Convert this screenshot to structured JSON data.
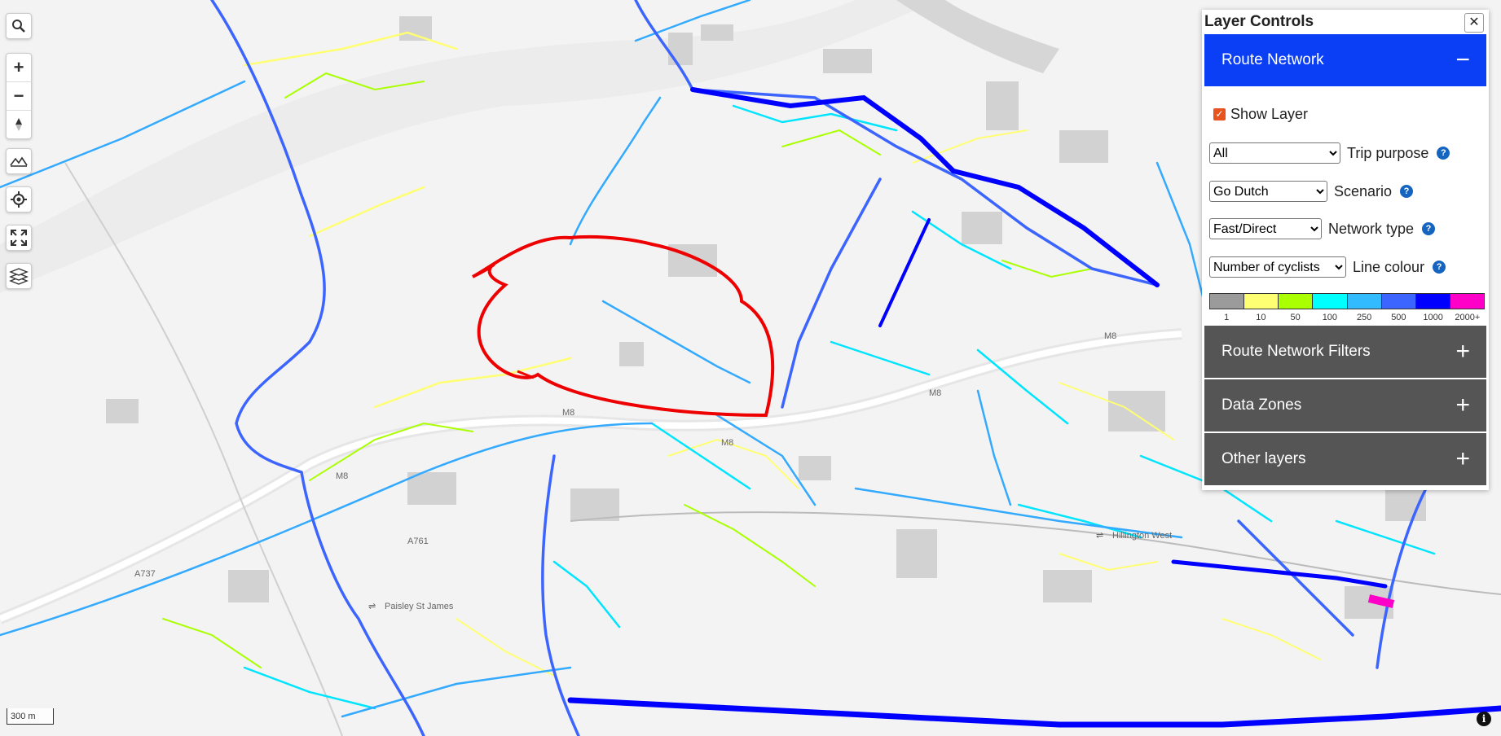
{
  "map": {
    "labels": {
      "m8": "M8",
      "a737": "A737",
      "a761": "A761",
      "paisley_st_james": "Paisley St James",
      "hillington_west": "Hillington West"
    },
    "scale_label": "300 m"
  },
  "toolbar": {
    "search_icon": "search-icon",
    "zoom_in": "+",
    "zoom_out": "−"
  },
  "panel": {
    "title": "Layer Controls",
    "close_label": "✕",
    "route_network": {
      "header": "Route Network",
      "toggle": "−",
      "show_layer_label": "Show Layer",
      "show_layer_checked": true,
      "trip_purpose": {
        "value": "All",
        "label": "Trip purpose"
      },
      "scenario": {
        "value": "Go Dutch",
        "label": "Scenario"
      },
      "network_type": {
        "value": "Fast/Direct",
        "label": "Network type"
      },
      "line_colour": {
        "value": "Number of cyclists",
        "label": "Line colour"
      },
      "help": "?",
      "legend": {
        "colors": [
          "#9b9b9b",
          "#ffff73",
          "#aaff00",
          "#00ffff",
          "#33bbff",
          "#3c64ff",
          "#0000ff",
          "#ff00c8"
        ],
        "labels": [
          "1",
          "10",
          "50",
          "100",
          "250",
          "500",
          "1000",
          "2000+"
        ]
      }
    },
    "filters": {
      "header": "Route Network Filters",
      "toggle": "+"
    },
    "data_zones": {
      "header": "Data Zones",
      "toggle": "+"
    },
    "other_layers": {
      "header": "Other layers",
      "toggle": "+"
    }
  },
  "colors": {
    "accent": "#0b3ff5",
    "section_collapsed": "#555555",
    "annotation": "#ee0000"
  }
}
